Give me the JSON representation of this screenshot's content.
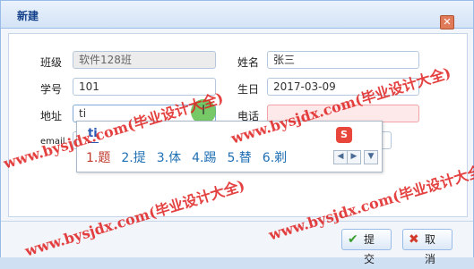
{
  "dialog": {
    "title": "新建"
  },
  "form": {
    "class_label": "班级",
    "class_value": "软件128班",
    "name_label": "姓名",
    "name_value": "张三",
    "student_id_label": "学号",
    "student_id_value": "101",
    "birthday_label": "生日",
    "birthday_value": "2017-03-09",
    "address_label": "地址",
    "address_value": "ti",
    "phone_label": "电话",
    "phone_value": "",
    "email_label": "email"
  },
  "ime": {
    "input": "ti",
    "candidates": [
      "1.题",
      "2.提",
      "3.体",
      "4.踢",
      "5.替",
      "6.剃"
    ],
    "logo": "S"
  },
  "buttons": {
    "submit": "提交",
    "cancel": "取消"
  },
  "watermark": {
    "text": "www.bysjdx.com(毕业设计大全)"
  },
  "colors": {
    "titlebar": "#d4e3f6",
    "invalid_field": "#fde9ea",
    "watermark": "#e02020",
    "cursor_highlight": "#5fbf4e"
  }
}
